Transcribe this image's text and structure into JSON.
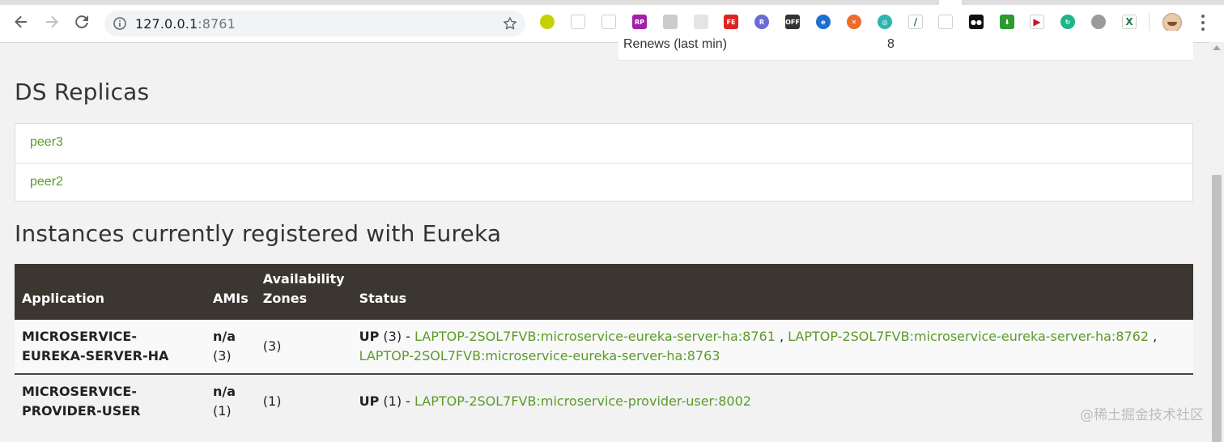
{
  "browser": {
    "url_host": "127.0.0.1",
    "url_port": ":8761",
    "extensions": [
      {
        "name": "ext-green-circle-icon",
        "color": "#c6d200",
        "glyph": ""
      },
      {
        "name": "ext-qr-icon",
        "color": "#ffffff",
        "glyph": ""
      },
      {
        "name": "ext-tree-icon",
        "color": "#ffffff",
        "glyph": ""
      },
      {
        "name": "ext-rp-icon",
        "color": "#a21fa8",
        "glyph": "RP"
      },
      {
        "name": "ext-folder-icon",
        "color": "#cccccc",
        "glyph": ""
      },
      {
        "name": "ext-grid-icon",
        "color": "#e4e4e4",
        "glyph": ""
      },
      {
        "name": "ext-fe-icon",
        "color": "#e02424",
        "glyph": "FE"
      },
      {
        "name": "ext-r-icon",
        "color": "#6b6bd6",
        "glyph": "R"
      },
      {
        "name": "ext-off-icon",
        "color": "#333333",
        "glyph": "OFF"
      },
      {
        "name": "ext-ie-icon",
        "color": "#1e6fd0",
        "glyph": "e"
      },
      {
        "name": "ext-orange-icon",
        "color": "#f06a2a",
        "glyph": "✕"
      },
      {
        "name": "ext-web-icon",
        "color": "#2bb6b0",
        "glyph": "◎"
      },
      {
        "name": "ext-slash-icon",
        "color": "#ffffff",
        "glyph": "/"
      },
      {
        "name": "ext-shield-icon",
        "color": "#ffffff",
        "glyph": ""
      },
      {
        "name": "ext-tampermonkey-icon",
        "color": "#111111",
        "glyph": "●●"
      },
      {
        "name": "ext-download-icon",
        "color": "#2d9a2d",
        "glyph": "⬇"
      },
      {
        "name": "ext-video-icon",
        "color": "#ffffff",
        "glyph": "▶"
      },
      {
        "name": "ext-refresh-icon",
        "color": "#1bb58c",
        "glyph": "↻"
      },
      {
        "name": "ext-gray-circle-icon",
        "color": "#9a9a9a",
        "glyph": ""
      },
      {
        "name": "ext-excel-icon",
        "color": "#ffffff",
        "glyph": "X"
      }
    ]
  },
  "status_table": {
    "renews_label": "Renews (last min)",
    "renews_value": "8"
  },
  "replicas": {
    "heading": "DS Replicas",
    "items": [
      "peer3",
      "peer2"
    ]
  },
  "instances": {
    "heading": "Instances currently registered with Eureka",
    "columns": {
      "application": "Application",
      "amis": "AMIs",
      "zones": "Availability Zones",
      "status": "Status"
    },
    "rows": [
      {
        "application": "MICROSERVICE-EUREKA-SERVER-HA",
        "ami_label": "n/a",
        "ami_count": "(3)",
        "zones": "(3)",
        "status_state": "UP",
        "status_count": "(3) -",
        "links": [
          "LAPTOP-2SOL7FVB:microservice-eureka-server-ha:8761",
          "LAPTOP-2SOL7FVB:microservice-eureka-server-ha:8762",
          "LAPTOP-2SOL7FVB:microservice-eureka-server-ha:8763"
        ]
      },
      {
        "application": "MICROSERVICE-PROVIDER-USER",
        "ami_label": "n/a",
        "ami_count": "(1)",
        "zones": "(1)",
        "status_state": "UP",
        "status_count": "(1) -",
        "links": [
          "LAPTOP-2SOL7FVB:microservice-provider-user:8002"
        ]
      }
    ]
  },
  "watermark": "@稀土掘金技术社区"
}
